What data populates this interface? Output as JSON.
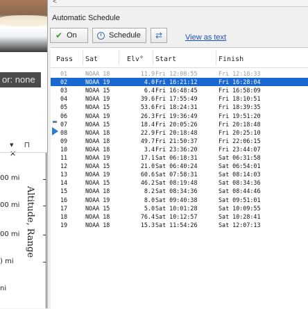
{
  "left": {
    "color_label": "or: none",
    "panel_controls": "▾ ⊓ ✕",
    "axis_title": "Altitude, Range",
    "axis_ticks": [
      "00 mi",
      "00 mi",
      "00 mi",
      ") mi",
      "ni"
    ]
  },
  "schedule": {
    "group_title": "Automatic Schedule",
    "toolbar": {
      "on_label": "On",
      "schedule_label": "Schedule",
      "view_as_text": "View as text"
    },
    "columns": [
      "Pass",
      "Sat",
      "Elv°",
      "Start",
      "Finish"
    ],
    "rows": [
      {
        "pass": "01",
        "sat": "NOAA 18",
        "elv": "11.9",
        "start": "Fri 12:08:55",
        "finish": "Fri 12:18:33",
        "state": "past"
      },
      {
        "pass": "02",
        "sat": "NOAA 19",
        "elv": "4.0",
        "start": "Fri 16:21:12",
        "finish": "Fri 16:28:04",
        "state": "selected"
      },
      {
        "pass": "03",
        "sat": "NOAA 15",
        "elv": "6.4",
        "start": "Fri 16:48:45",
        "finish": "Fri 16:58:09",
        "state": ""
      },
      {
        "pass": "04",
        "sat": "NOAA 19",
        "elv": "39.6",
        "start": "Fri 17:55:49",
        "finish": "Fri 18:10:51",
        "state": ""
      },
      {
        "pass": "05",
        "sat": "NOAA 15",
        "elv": "53.6",
        "start": "Fri 18:24:31",
        "finish": "Fri 18:39:35",
        "state": ""
      },
      {
        "pass": "06",
        "sat": "NOAA 19",
        "elv": "26.3",
        "start": "Fri 19:36:49",
        "finish": "Fri 19:51:20",
        "state": ""
      },
      {
        "pass": "07",
        "sat": "NOAA 15",
        "elv": "18.4",
        "start": "Fri 20:05:26",
        "finish": "Fri 20:18:48",
        "state": ""
      },
      {
        "pass": "08",
        "sat": "NOAA 18",
        "elv": "22.9",
        "start": "Fri 20:18:48",
        "finish": "Fri 20:25:10",
        "state": ""
      },
      {
        "pass": "09",
        "sat": "NOAA 18",
        "elv": "49.7",
        "start": "Fri 21:50:37",
        "finish": "Fri 22:06:15",
        "state": ""
      },
      {
        "pass": "10",
        "sat": "NOAA 18",
        "elv": "3.4",
        "start": "Fri 23:36:20",
        "finish": "Fri 23:44:07",
        "state": ""
      },
      {
        "pass": "11",
        "sat": "NOAA 19",
        "elv": "17.1",
        "start": "Sat 06:18:31",
        "finish": "Sat 06:31:58",
        "state": ""
      },
      {
        "pass": "12",
        "sat": "NOAA 15",
        "elv": "21.0",
        "start": "Sat 06:40:24",
        "finish": "Sat 06:54:01",
        "state": ""
      },
      {
        "pass": "13",
        "sat": "NOAA 19",
        "elv": "60.6",
        "start": "Sat 07:58:31",
        "finish": "Sat 08:14:03",
        "state": ""
      },
      {
        "pass": "14",
        "sat": "NOAA 15",
        "elv": "46.2",
        "start": "Sat 08:19:48",
        "finish": "Sat 08:34:36",
        "state": ""
      },
      {
        "pass": "15",
        "sat": "NOAA 18",
        "elv": "8.2",
        "start": "Sat 08:34:36",
        "finish": "Sat 08:44:46",
        "state": ""
      },
      {
        "pass": "16",
        "sat": "NOAA 19",
        "elv": "8.0",
        "start": "Sat 09:40:38",
        "finish": "Sat 09:51:01",
        "state": ""
      },
      {
        "pass": "17",
        "sat": "NOAA 15",
        "elv": "5.0",
        "start": "Sat 10:01:28",
        "finish": "Sat 10:09:55",
        "state": ""
      },
      {
        "pass": "18",
        "sat": "NOAA 18",
        "elv": "76.4",
        "start": "Sat 10:12:57",
        "finish": "Sat 10:28:41",
        "state": ""
      },
      {
        "pass": "19",
        "sat": "NOAA 18",
        "elv": "15.3",
        "start": "Sat 11:54:26",
        "finish": "Sat 12:07:13",
        "state": ""
      }
    ]
  },
  "colors": {
    "selection": "#1967d2",
    "link": "#1a4fc4",
    "on_check": "#2e9e2e",
    "past_row_text": "#9a9a9a"
  },
  "icons": {
    "on": "check-icon",
    "schedule": "clock-icon",
    "refresh": "refresh-icon",
    "current_pass": "play-arrow-icon"
  }
}
